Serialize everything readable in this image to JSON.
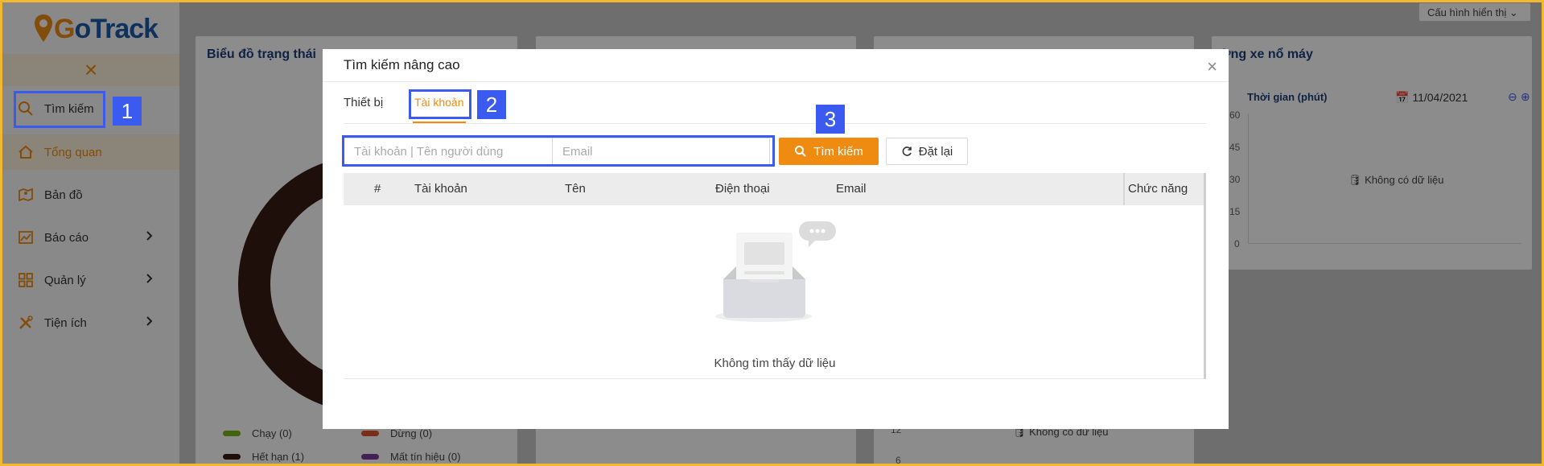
{
  "app": {
    "logo_text": "GoTrack",
    "config_label": "Cấu hình hiển thị",
    "collapse_symbol": "×"
  },
  "sidebar": {
    "items": [
      {
        "label": "Tìm kiếm",
        "icon": "search-icon"
      },
      {
        "label": "Tổng quan",
        "icon": "home-icon",
        "active": true
      },
      {
        "label": "Bản đồ",
        "icon": "map-icon"
      },
      {
        "label": "Báo cáo",
        "icon": "chart-icon",
        "has_submenu": true
      },
      {
        "label": "Quản lý",
        "icon": "grid-icon",
        "has_submenu": true
      },
      {
        "label": "Tiện ích",
        "icon": "tools-icon",
        "has_submenu": true
      }
    ]
  },
  "dashboard": {
    "status_chart_title": "Biểu đồ trạng thái",
    "legend": [
      {
        "label": "Chạy (0)",
        "color": "#7cb518"
      },
      {
        "label": "Dừng (0)",
        "color": "#e0552b"
      },
      {
        "label": "Hết hạn (1)",
        "color": "#3a1c14"
      },
      {
        "label": "Mất tín hiệu (0)",
        "color": "#7a3b9c"
      }
    ],
    "engine_card_title": "ừng xe nổ máy",
    "engine_y_title": "Thời gian (phút)",
    "engine_date": "11/04/2021",
    "engine_y_ticks": [
      "60",
      "45",
      "30",
      "15",
      "0"
    ],
    "engine_empty": "Không có dữ liệu",
    "bottom_empty": "Không có dữ liệu",
    "bottom_ticks": [
      "12",
      "6"
    ]
  },
  "modal": {
    "title": "Tìm kiếm nâng cao",
    "close_symbol": "×",
    "tabs": [
      {
        "label": "Thiết bị",
        "active": false
      },
      {
        "label": "Tài khoản",
        "active": true
      }
    ],
    "search": {
      "account_placeholder": "Tài khoản | Tên người dùng",
      "email_placeholder": "Email",
      "search_button": "Tìm kiếm",
      "reset_button": "Đặt lại"
    },
    "table": {
      "columns": [
        "#",
        "Tài khoản",
        "Tên",
        "Điện thoại",
        "Email",
        "Chức năng"
      ],
      "rows": [],
      "empty_text": "Không tìm thấy dữ liệu"
    }
  },
  "annotations": [
    "1",
    "2",
    "3"
  ],
  "colors": {
    "accent": "#ef8b10",
    "brand_blue": "#1d5aa8",
    "annotation": "#3b5bf0"
  }
}
